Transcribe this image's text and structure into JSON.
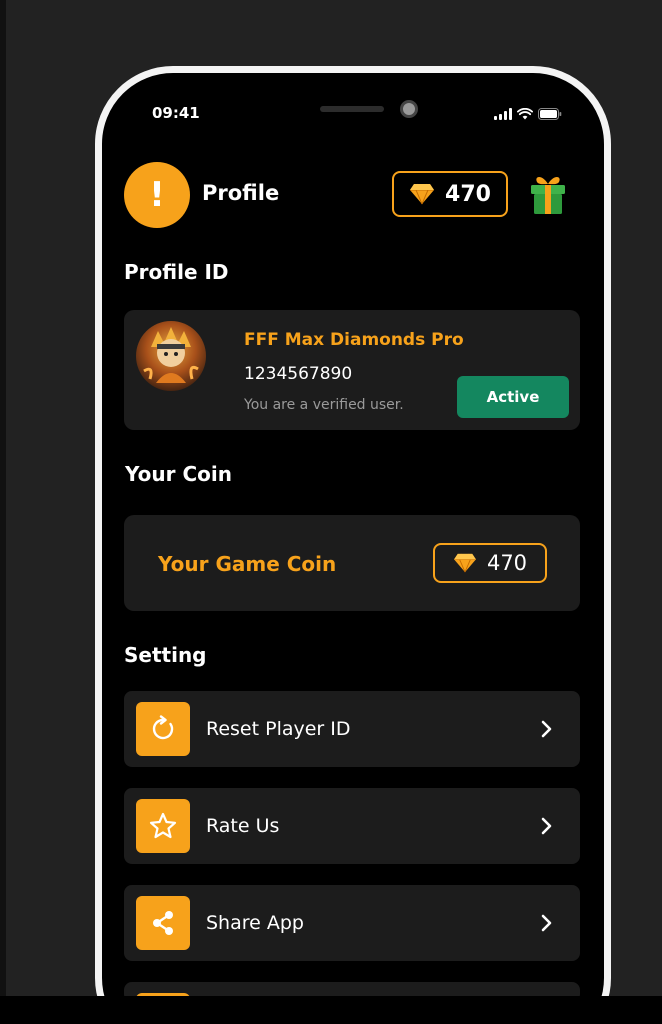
{
  "status_bar": {
    "time": "09:41"
  },
  "header": {
    "title": "Profile",
    "alert_glyph": "!",
    "coin_count": "470"
  },
  "profile": {
    "section_title": "Profile ID",
    "name": "FFF Max Diamonds Pro",
    "player_id": "1234567890",
    "verified_text": "You are a verified user.",
    "status_button": "Active"
  },
  "coin": {
    "section_title": "Your Coin",
    "label": "Your Game Coin",
    "value": "470"
  },
  "settings": {
    "section_title": "Setting",
    "items": [
      {
        "label": "Reset Player ID",
        "icon": "reset-icon"
      },
      {
        "label": "Rate Us",
        "icon": "star-icon"
      },
      {
        "label": "Share App",
        "icon": "share-icon"
      }
    ]
  },
  "colors": {
    "accent": "#f7a21b",
    "active_green": "#14875f",
    "card_bg": "#1c1c1c",
    "background": "#000000"
  }
}
